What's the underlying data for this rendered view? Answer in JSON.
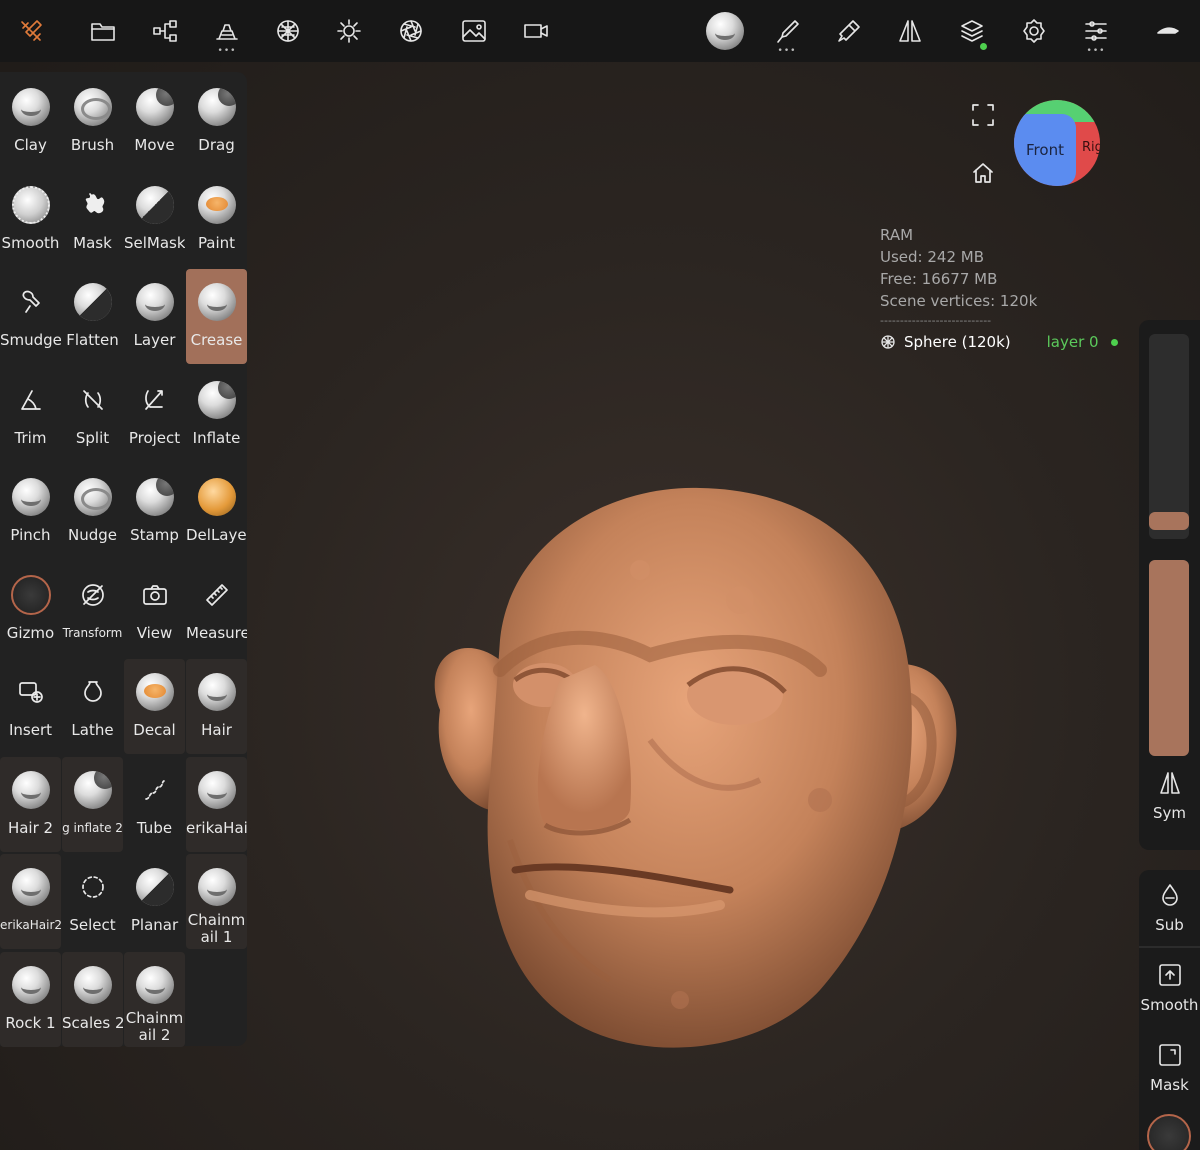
{
  "toolbar": {
    "left_icons": [
      "tools-icon",
      "folder-icon",
      "share-nodes-icon",
      "scene-stack-icon",
      "topology-icon",
      "light-icon",
      "shading-icon",
      "background-image-icon",
      "video-camera-icon"
    ],
    "right_icons": [
      "brush-preview-icon",
      "brush-stroke-icon",
      "painting-icon",
      "symmetry-icon",
      "layers-icon",
      "settings-icon",
      "sliders-icon",
      "extra-icon"
    ],
    "accent_color": "#e07a3a"
  },
  "tools": [
    {
      "label": "Clay"
    },
    {
      "label": "Brush"
    },
    {
      "label": "Move"
    },
    {
      "label": "Drag"
    },
    {
      "label": "Smooth"
    },
    {
      "label": "Mask"
    },
    {
      "label": "SelMask"
    },
    {
      "label": "Paint"
    },
    {
      "label": "Smudge"
    },
    {
      "label": "Flatten"
    },
    {
      "label": "Layer"
    },
    {
      "label": "Crease"
    },
    {
      "label": "Trim"
    },
    {
      "label": "Split"
    },
    {
      "label": "Project"
    },
    {
      "label": "Inflate"
    },
    {
      "label": "Pinch"
    },
    {
      "label": "Nudge"
    },
    {
      "label": "Stamp"
    },
    {
      "label": "DelLayer"
    },
    {
      "label": "Gizmo"
    },
    {
      "label": "Transform"
    },
    {
      "label": "View"
    },
    {
      "label": "Measure"
    },
    {
      "label": "Insert"
    },
    {
      "label": "Lathe"
    },
    {
      "label": "Decal"
    },
    {
      "label": "Hair"
    },
    {
      "label": "Hair 2"
    },
    {
      "label": "g inflate 2"
    },
    {
      "label": "Tube"
    },
    {
      "label": "erikaHair"
    },
    {
      "label": "erikaHair2"
    },
    {
      "label": "Select"
    },
    {
      "label": "Planar"
    },
    {
      "label": "Chainm ail 1"
    },
    {
      "label": "Rock 1"
    },
    {
      "label": "Scales 2"
    },
    {
      "label": "Chainm ail 2"
    }
  ],
  "active_tool": "Crease",
  "active_color": "#a2705a",
  "viewcube": {
    "front": "Front",
    "right": "Rig"
  },
  "stats": {
    "title": "RAM",
    "used": "Used: 242 MB",
    "free": "Free: 16677 MB",
    "vertices": "Scene vertices: 120k",
    "separator": "----------------------------"
  },
  "scene": {
    "object": "Sphere (120k)",
    "layer": "layer 0"
  },
  "sliders": {
    "radius_fraction": 0.05,
    "intensity_fraction": 1.0
  },
  "right_panel": {
    "sym": "Sym",
    "sub": "Sub",
    "smooth": "Smooth",
    "mask": "Mask"
  }
}
